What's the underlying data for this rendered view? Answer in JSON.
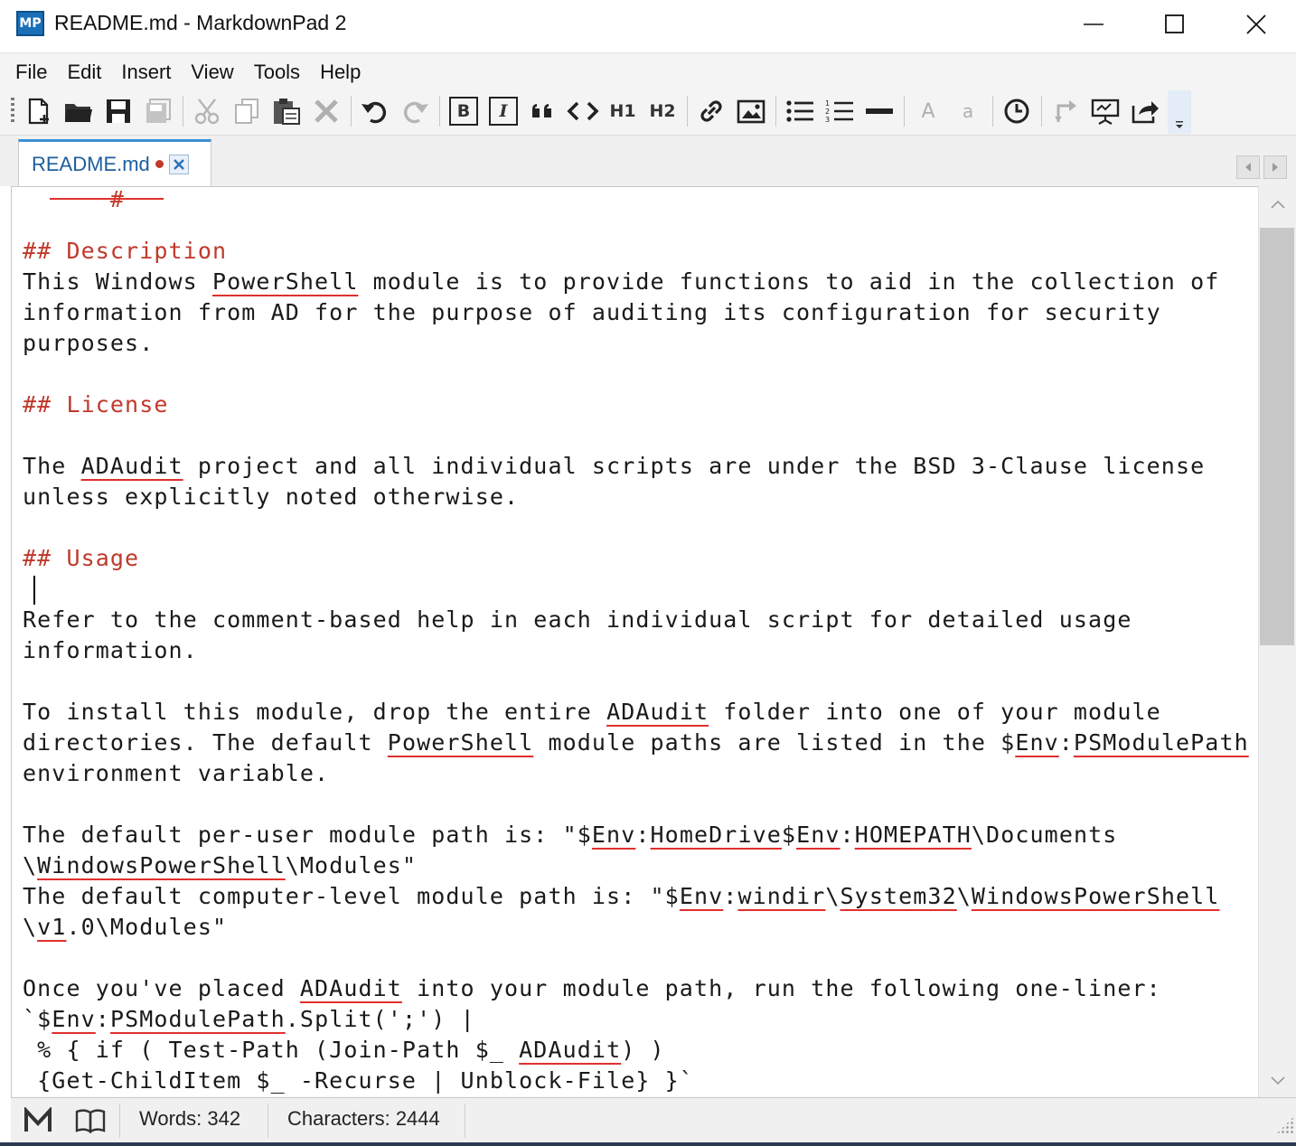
{
  "window": {
    "title": "README.md - MarkdownPad 2",
    "app_icon_text": "MP"
  },
  "menu": [
    "File",
    "Edit",
    "Insert",
    "View",
    "Tools",
    "Help"
  ],
  "toolbar": {
    "bold_label": "B",
    "italic_label": "I",
    "h1_label": "H1",
    "h2_label": "H2",
    "uppercase_label": "A",
    "lowercase_label": "a"
  },
  "tab": {
    "label": "README.md",
    "modified": true
  },
  "editor": {
    "lines": [
      {
        "type": "heading",
        "parts": [
          [
            "## Description",
            false
          ]
        ]
      },
      {
        "type": "text",
        "parts": [
          [
            "This Windows ",
            false
          ],
          [
            "PowerShell",
            true
          ],
          [
            " module is to provide functions to aid in the collection of",
            false
          ]
        ]
      },
      {
        "type": "text",
        "parts": [
          [
            "information from AD for the purpose of auditing its configuration for security",
            false
          ]
        ]
      },
      {
        "type": "text",
        "parts": [
          [
            "purposes.",
            false
          ]
        ]
      },
      {
        "type": "blank",
        "parts": []
      },
      {
        "type": "heading",
        "parts": [
          [
            "## License",
            false
          ]
        ]
      },
      {
        "type": "blank",
        "parts": []
      },
      {
        "type": "text",
        "parts": [
          [
            "The ",
            false
          ],
          [
            "ADAudit",
            true
          ],
          [
            " project and all individual scripts are under the BSD 3-Clause license",
            false
          ]
        ]
      },
      {
        "type": "text",
        "parts": [
          [
            "unless explicitly noted otherwise.",
            false
          ]
        ]
      },
      {
        "type": "blank",
        "parts": []
      },
      {
        "type": "heading",
        "parts": [
          [
            "## Usage",
            false
          ]
        ]
      },
      {
        "type": "blank",
        "parts": []
      },
      {
        "type": "text",
        "parts": [
          [
            "Refer to the comment-based help in each individual script for detailed usage",
            false
          ]
        ]
      },
      {
        "type": "text",
        "parts": [
          [
            "information.",
            false
          ]
        ]
      },
      {
        "type": "blank",
        "parts": []
      },
      {
        "type": "text",
        "parts": [
          [
            "To install this module, drop the entire ",
            false
          ],
          [
            "ADAudit",
            true
          ],
          [
            " folder into one of your module",
            false
          ]
        ]
      },
      {
        "type": "text",
        "parts": [
          [
            "directories. The default ",
            false
          ],
          [
            "PowerShell",
            true
          ],
          [
            " module paths are listed in the $",
            false
          ],
          [
            "Env",
            true
          ],
          [
            ":",
            false
          ],
          [
            "PSModulePath",
            true
          ]
        ]
      },
      {
        "type": "text",
        "parts": [
          [
            "environment variable.",
            false
          ]
        ]
      },
      {
        "type": "blank",
        "parts": []
      },
      {
        "type": "text",
        "parts": [
          [
            "The default per-user module path is: \"$",
            false
          ],
          [
            "Env",
            true
          ],
          [
            ":",
            false
          ],
          [
            "HomeDrive",
            true
          ],
          [
            "$",
            false
          ],
          [
            "Env",
            true
          ],
          [
            ":",
            false
          ],
          [
            "HOMEPATH",
            true
          ],
          [
            "\\Documents",
            false
          ]
        ]
      },
      {
        "type": "text",
        "parts": [
          [
            "\\",
            false
          ],
          [
            "WindowsPowerShell",
            true
          ],
          [
            "\\Modules\"",
            false
          ]
        ]
      },
      {
        "type": "text",
        "parts": [
          [
            "The default computer-level module path is: \"$",
            false
          ],
          [
            "Env",
            true
          ],
          [
            ":",
            false
          ],
          [
            "windir",
            true
          ],
          [
            "\\",
            false
          ],
          [
            "System32",
            true
          ],
          [
            "\\",
            false
          ],
          [
            "WindowsPowerShell",
            true
          ]
        ]
      },
      {
        "type": "text",
        "parts": [
          [
            "\\",
            false
          ],
          [
            "v1",
            true
          ],
          [
            ".0\\Modules\"",
            false
          ]
        ]
      },
      {
        "type": "blank",
        "parts": []
      },
      {
        "type": "text",
        "parts": [
          [
            "Once you've placed ",
            false
          ],
          [
            "ADAudit",
            true
          ],
          [
            " into your module path, run the following one-liner:",
            false
          ]
        ]
      },
      {
        "type": "text",
        "parts": [
          [
            "`$",
            false
          ],
          [
            "Env",
            true
          ],
          [
            ":",
            false
          ],
          [
            "PSModulePath",
            true
          ],
          [
            ".Split(';') |",
            false
          ]
        ]
      },
      {
        "type": "text",
        "parts": [
          [
            " % { if ( Test-Path (Join-Path $_ ",
            false
          ],
          [
            "ADAudit",
            true
          ],
          [
            ") )",
            false
          ]
        ]
      },
      {
        "type": "text",
        "parts": [
          [
            " {Get-ChildItem $_ -Recurse | Unblock-File} }`",
            false
          ]
        ]
      }
    ]
  },
  "statusbar": {
    "words": "Words: 342",
    "characters": "Characters: 2444"
  },
  "colors": {
    "heading": "#c0392b",
    "spellcheck_underline": "#e0302e",
    "tab_accent": "#3d8fd6"
  }
}
